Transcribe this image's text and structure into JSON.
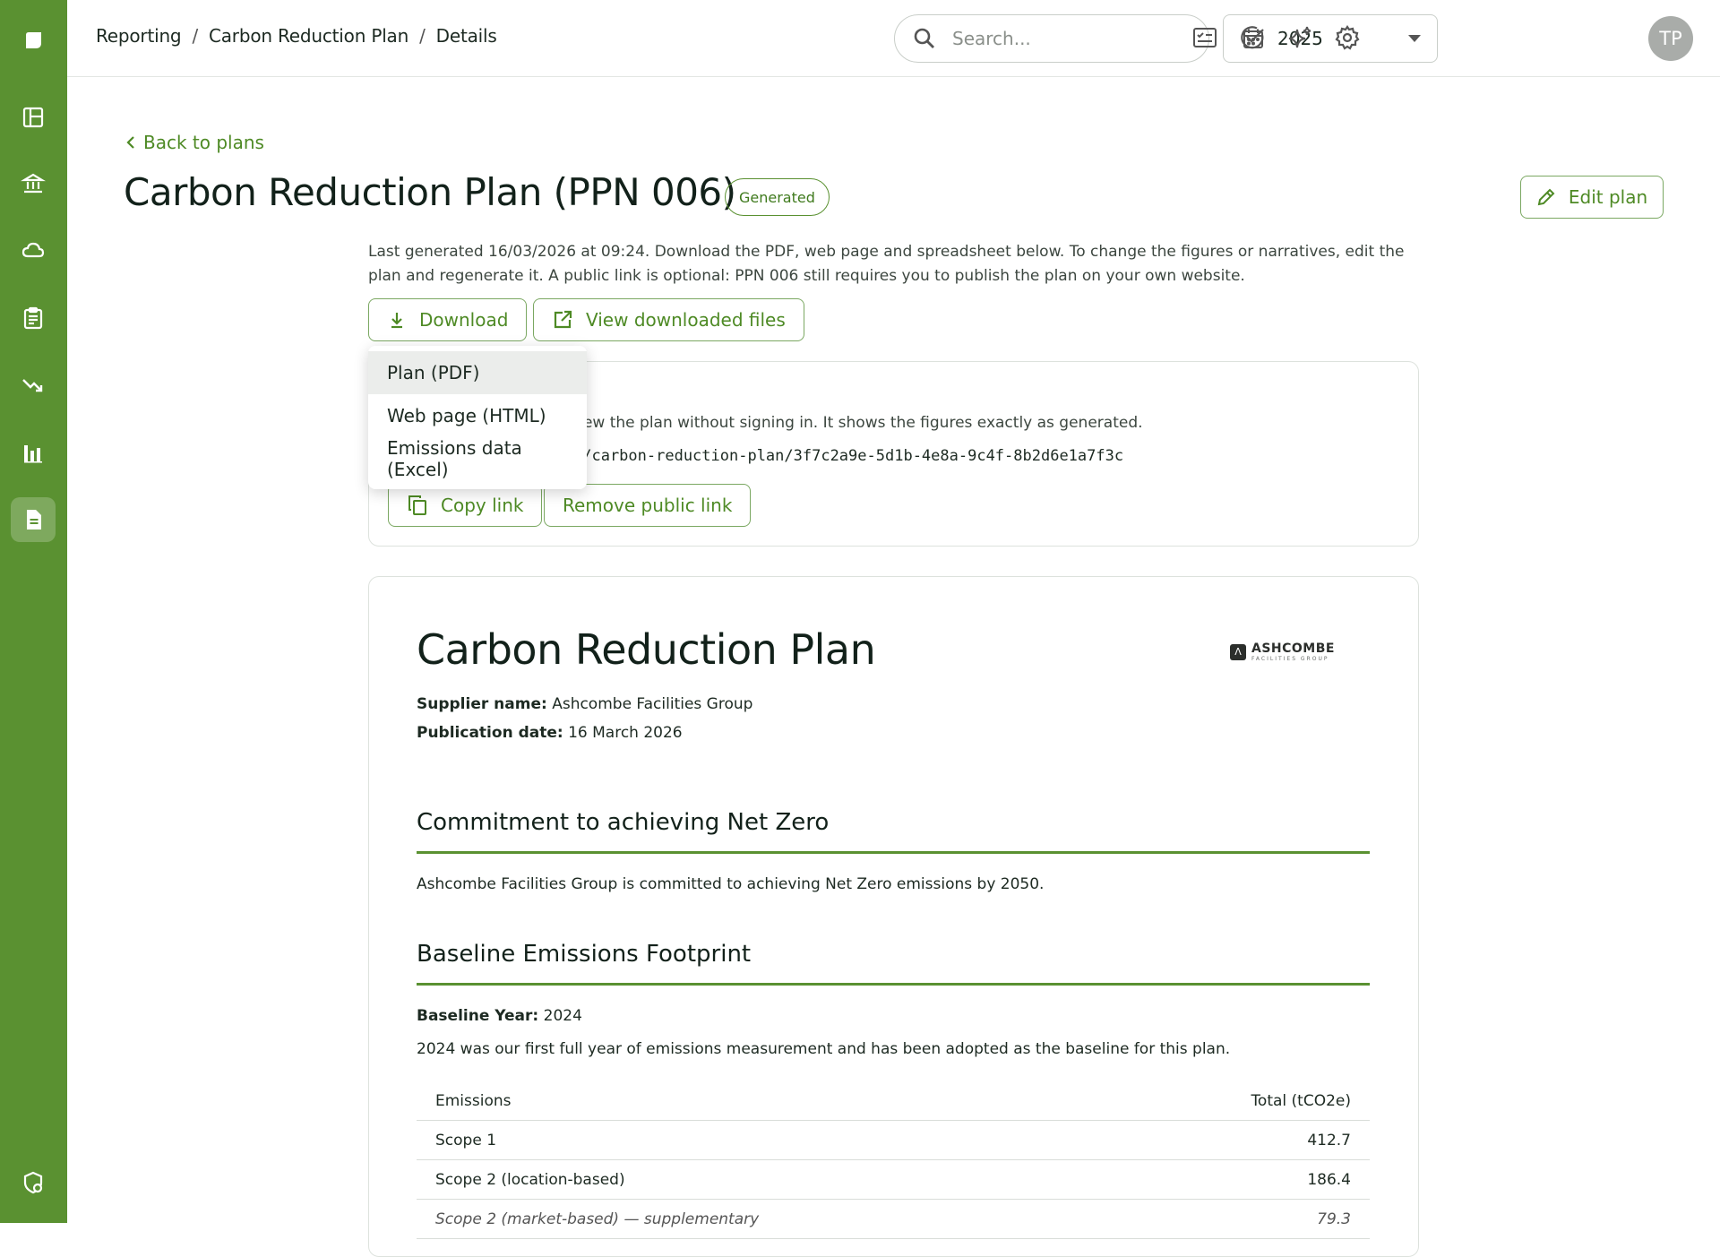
{
  "breadcrumb": [
    "Reporting",
    "Carbon Reduction Plan",
    "Details"
  ],
  "search": {
    "placeholder": "Search..."
  },
  "year_select": {
    "value": "2025"
  },
  "user": {
    "initials": "TP"
  },
  "back_link": "Back to plans",
  "page_title": "Carbon Reduction Plan (PPN 006)",
  "status_badge": "Generated",
  "edit_button": "Edit plan",
  "description": "Last generated 16/03/2026 at 09:24. Download the PDF, web page and spreadsheet below. To change the figures or narratives, edit the plan and regenerate it. A public link is optional: PPN 006 still requires you to publish the plan on your own website.",
  "actions": {
    "download": "Download",
    "view_files": "View downloaded files"
  },
  "download_menu": [
    "Plan (PDF)",
    "Web page (HTML)",
    "Emissions data (Excel)"
  ],
  "public_link": {
    "description_visible": "n view the plan without signing in. It shows the figures exactly as generated.",
    "url_visible": "c/carbon-reduction-plan/3f7c2a9e-5d1b-4e8a-9c4f-8b2d6e1a7f3c",
    "copy_button": "Copy link",
    "remove_button": "Remove public link"
  },
  "document": {
    "title": "Carbon Reduction Plan",
    "logo": {
      "name": "ASHCOMBE",
      "sub": "FACILITIES GROUP"
    },
    "supplier_label": "Supplier name:",
    "supplier_value": "Ashcombe Facilities Group",
    "pubdate_label": "Publication date:",
    "pubdate_value": "16 March 2026",
    "commitment_heading": "Commitment to achieving Net Zero",
    "commitment_text": "Ashcombe Facilities Group is committed to achieving Net Zero emissions by 2050.",
    "baseline_heading": "Baseline Emissions Footprint",
    "baseline_year_label": "Baseline Year:",
    "baseline_year_value": "2024",
    "baseline_text": "2024 was our first full year of emissions measurement and has been adopted as the baseline for this plan.",
    "table": {
      "headers": [
        "Emissions",
        "Total (tCO2e)"
      ],
      "rows": [
        {
          "label": "Scope 1",
          "value": "412.7"
        },
        {
          "label": "Scope 2 (location-based)",
          "value": "186.4"
        },
        {
          "label": "Scope 2 (market-based) — supplementary",
          "value": "79.3"
        }
      ]
    }
  },
  "colors": {
    "brand": "#5a9131",
    "accent_text": "#4e8a25"
  }
}
